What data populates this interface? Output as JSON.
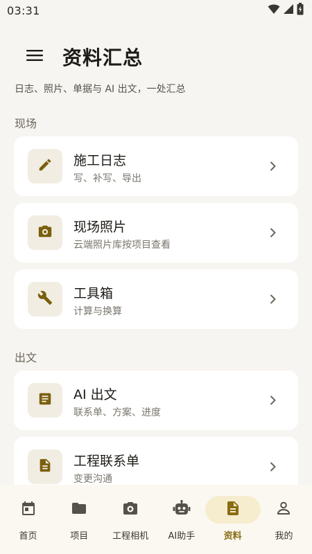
{
  "status_bar": {
    "time": "03:31"
  },
  "header": {
    "title": "资料汇总",
    "subtitle": "日志、照片、单据与 AI 出文，一处汇总"
  },
  "sections": {
    "site": {
      "label": "现场"
    },
    "writing": {
      "label": "出文"
    }
  },
  "cards": [
    {
      "title": "施工日志",
      "desc": "写、补写、导出",
      "icon": "pencil-icon"
    },
    {
      "title": "现场照片",
      "desc": "云端照片库按项目查看",
      "icon": "camera-icon"
    },
    {
      "title": "工具箱",
      "desc": "计算与换算",
      "icon": "wrench-icon"
    },
    {
      "title": "AI 出文",
      "desc": "联系单、方案、进度",
      "icon": "article-icon"
    },
    {
      "title": "工程联系单",
      "desc": "变更沟通",
      "icon": "document-icon"
    }
  ],
  "bottom_nav": [
    {
      "label": "首页",
      "icon": "calendar-icon",
      "active": false
    },
    {
      "label": "项目",
      "icon": "folder-icon",
      "active": false
    },
    {
      "label": "工程相机",
      "icon": "camera-icon",
      "active": false
    },
    {
      "label": "AI助手",
      "icon": "robot-icon",
      "active": false
    },
    {
      "label": "资料",
      "icon": "document-icon",
      "active": true
    },
    {
      "label": "我的",
      "icon": "person-icon",
      "active": false
    }
  ],
  "colors": {
    "accent": "#8a6d12",
    "accent_container": "#f6edcf",
    "background": "#f7f5f1",
    "card": "#ffffff",
    "icon_tile": "#f1ede3"
  }
}
